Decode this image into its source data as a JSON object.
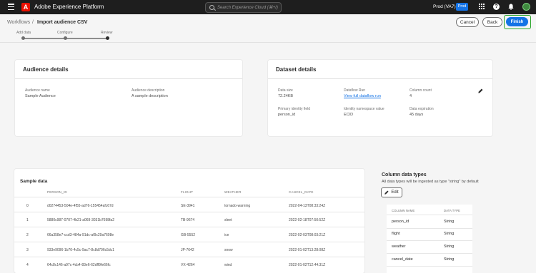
{
  "topbar": {
    "app_title": "Adobe Experience Platform",
    "search_placeholder": "Search Experience Cloud (⌘+/)",
    "org": "Prod (VA7)",
    "env_badge": "Prod"
  },
  "breadcrumb": {
    "parent": "Workflows",
    "separator": "/",
    "current": "Import audience CSV"
  },
  "steps": [
    "Add data",
    "Configure",
    "Review"
  ],
  "actions": {
    "cancel": "Cancel",
    "back": "Back",
    "finish": "Finish"
  },
  "audience_details": {
    "title": "Audience details",
    "name_label": "Audience name",
    "name_value": "Sample Audience",
    "desc_label": "Audience description",
    "desc_value": "A sample description"
  },
  "dataset_details": {
    "title": "Dataset details",
    "size_label": "Data size",
    "size_value": "72.24KB",
    "dataflow_label": "Dataflow Run",
    "dataflow_link": "View full dataflow run",
    "columns_label": "Column count",
    "columns_value": "4",
    "primary_label": "Primary identity field",
    "primary_value": "person_id",
    "namespace_label": "Identity namespace value",
    "namespace_value": "ECID",
    "expiration_label": "Data expiration",
    "expiration_value": "45 days"
  },
  "sample_data": {
    "title": "Sample data",
    "columns": [
      "PERSON_ID",
      "FLIGHT",
      "WEATHER",
      "CANCEL_DATE"
    ],
    "rows": [
      {
        "idx": "0",
        "person_id": "d0274453-504e-4f55-ad76-155454afc67d",
        "flight": "SE-3941",
        "weather": "tornado-warning",
        "cancel_date": "2022-04-13T08:33:24Z"
      },
      {
        "idx": "1",
        "person_id": "5880c987-0707-4b21-a069-3031b7698fa2",
        "flight": "TB-9674",
        "weather": "sleet",
        "cancel_date": "2022-02-18T07:50:52Z"
      },
      {
        "idx": "2",
        "person_id": "66a358e7-ccd3-484a-91dc-af9c29a7608e",
        "flight": "GB-5552",
        "weather": "ice",
        "cancel_date": "2022-02-03T08:03:21Z"
      },
      {
        "idx": "3",
        "person_id": "933e9096-1b70-4c5c-9ac7-8c8d706c5dc1",
        "flight": "JP-7642",
        "weather": "snow",
        "cancel_date": "2022-01-02T13:28:08Z"
      },
      {
        "idx": "4",
        "person_id": "64c8c146-a97c-4cb4-83e6-62dff9fe66fc",
        "flight": "VX-4264",
        "weather": "wind",
        "cancel_date": "2022-01-02T12:44:31Z"
      }
    ]
  },
  "column_types": {
    "title": "Column data types",
    "subtitle": "All data types will be ingested as type \"string\" by default",
    "edit_label": "Edit",
    "headers": [
      "COLUMN NAME",
      "DATA TYPE"
    ],
    "rows": [
      {
        "name": "person_id",
        "type": "String"
      },
      {
        "name": "flight",
        "type": "String"
      },
      {
        "name": "weather",
        "type": "String"
      },
      {
        "name": "cancel_date",
        "type": "String"
      }
    ]
  },
  "colors": {
    "accent": "#1473e6",
    "finish_highlight": "#2aa52a",
    "topbar": "#1e1e1e",
    "logo": "#eb1000"
  },
  "icons": [
    "menu-icon",
    "adobe-logo",
    "search-icon",
    "apps-grid-icon",
    "help-icon",
    "bell-icon",
    "avatar",
    "pencil-icon"
  ]
}
